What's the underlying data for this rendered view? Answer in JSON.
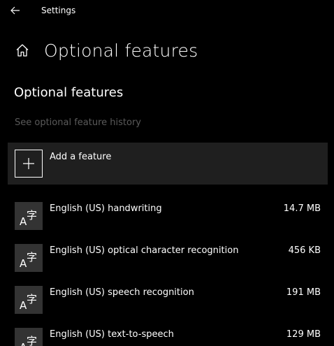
{
  "window": {
    "app_title": "Settings"
  },
  "header": {
    "title": "Optional features"
  },
  "section": {
    "title": "Optional features",
    "history_link": "See optional feature history"
  },
  "add_feature": {
    "label": "Add a feature"
  },
  "features": [
    {
      "name": "English (US) handwriting",
      "size": "14.7 MB",
      "icon": "language-icon"
    },
    {
      "name": "English (US) optical character recognition",
      "size": "456 KB",
      "icon": "language-icon"
    },
    {
      "name": "English (US) speech recognition",
      "size": "191 MB",
      "icon": "language-icon"
    },
    {
      "name": "English (US) text-to-speech",
      "size": "129 MB",
      "icon": "language-icon"
    }
  ],
  "colors": {
    "background": "#000000",
    "card": "#1f1f1f",
    "icon_tile": "#333333",
    "muted_text": "#5a5a5a"
  }
}
